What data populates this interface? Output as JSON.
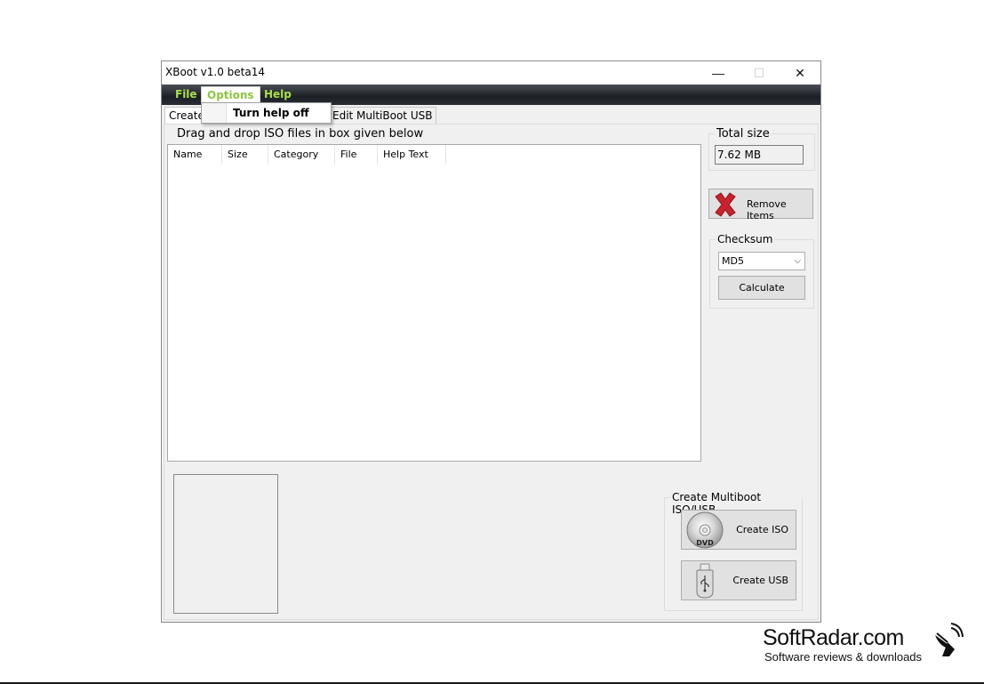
{
  "window": {
    "title": "XBoot v1.0 beta14",
    "controls": {
      "minimize": "—",
      "maximize": "☐",
      "close": "✕"
    }
  },
  "menubar": {
    "items": [
      "File",
      "Options",
      "Help"
    ],
    "open_menu": "Options",
    "dropdown_items": [
      "Turn help off"
    ]
  },
  "tabs": {
    "items": [
      "Create M",
      "Edit MultiBoot USB"
    ],
    "active": "Create M"
  },
  "main": {
    "drag_label": "Drag and drop ISO files in box given below",
    "columns": [
      "Name",
      "Size",
      "Category",
      "File",
      "Help Text"
    ]
  },
  "total_size": {
    "title": "Total size",
    "value": "7.62 MB"
  },
  "remove_button": {
    "label": "Remove Items",
    "icon": "red-x-icon"
  },
  "checksum": {
    "title": "Checksum",
    "selected": "MD5",
    "calculate_label": "Calculate"
  },
  "create": {
    "title": "Create Multiboot ISO/USB",
    "iso_label": "Create ISO",
    "usb_label": "Create USB",
    "iso_icon_text": "DVD"
  },
  "watermark": {
    "title": "SoftRadar.com",
    "subtitle": "Software reviews & downloads"
  },
  "colors": {
    "menu_text": "#a8e04a",
    "menubar_bg": "#1c1f24",
    "remove_icon": "#c8232c"
  }
}
